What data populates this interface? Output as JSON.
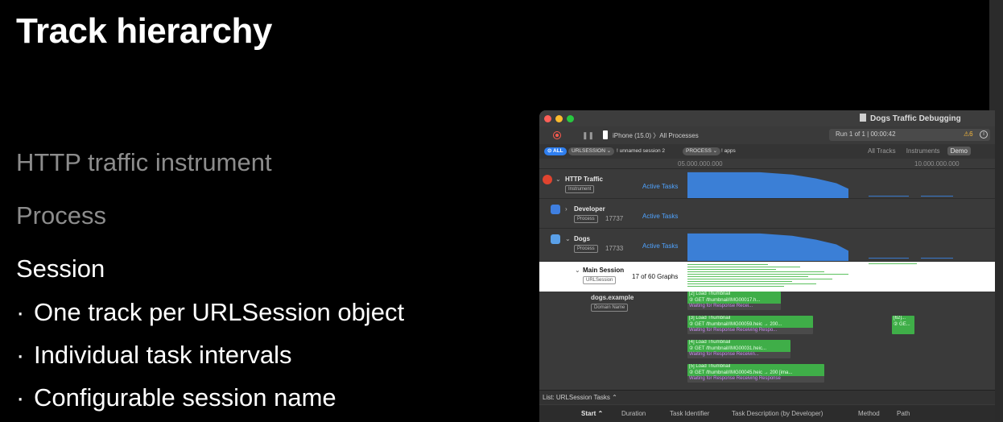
{
  "slide": {
    "title": "Track hierarchy",
    "levels": [
      "HTTP traffic instrument",
      "Process",
      "Session"
    ],
    "bullets": [
      "One track per URLSession object",
      "Individual task intervals",
      "Configurable session name"
    ]
  },
  "window": {
    "title": "Dogs Traffic Debugging",
    "target": "iPhone (15.0) 〉All Processes",
    "run_label": "Run 1 of 1  |  00:00:42",
    "warning_count": "6",
    "filter": {
      "all_label": "ALL",
      "urlsession_token": "URLSESSION ⌄",
      "urlsession_value": "! unnamed session 2",
      "process_token": "PROCESS ⌄",
      "process_value": "! apps"
    },
    "view_tabs": [
      "All Tracks",
      "Instruments",
      "Demo"
    ],
    "selected_tab": "Demo",
    "ruler": [
      "05.000.000.000",
      "10.000.000.000"
    ],
    "tracks": [
      {
        "name": "HTTP Traffic",
        "badge": "Instrument",
        "pid": "",
        "subtrack": "Active Tasks"
      },
      {
        "name": "Developer",
        "badge": "Process",
        "pid": "17737",
        "subtrack": "Active Tasks"
      },
      {
        "name": "Dogs",
        "badge": "Process",
        "pid": "17733",
        "subtrack": "Active Tasks"
      }
    ],
    "session": {
      "name": "Main Session",
      "badge": "URLSession",
      "graphs": "17 of 60 Graphs"
    },
    "domain": {
      "name": "dogs.example",
      "badge": "Domain Name"
    },
    "tasks": [
      {
        "title": "[2] Load Thumbnail",
        "request": "② GET /thumbnail/IMG00017.h...",
        "phase": "Waiting for Response   Recei..."
      },
      {
        "title": "[3] Load Thumbnail",
        "request": "② GET /thumbnail/IMG00059.heic → 200...",
        "phase": "Waiting for Response   Receiving Respo..."
      },
      {
        "title": "[4] Load Thumbnail",
        "request": "② GET /thumbnail/IMG00031.heic...",
        "phase": "Waiting for Response   Receivin..."
      },
      {
        "title": "[5] Load Thumbnail",
        "request": "② GET /thumbnail/IMG00045.heic → 200 [ima...",
        "phase": "Waiting for Response   Receiving Response"
      },
      {
        "title": "[62]...",
        "request": "② GE...",
        "phase": ""
      }
    ],
    "list_label": "List: URLSession Tasks ⌃",
    "columns": [
      "Start",
      "Duration",
      "Task Identifier",
      "Task Description (by Developer)",
      "Method",
      "Path"
    ],
    "colors": {
      "accent": "#4fa3ff",
      "task_green": "#3fae48",
      "highlight": "#ffffff"
    }
  }
}
